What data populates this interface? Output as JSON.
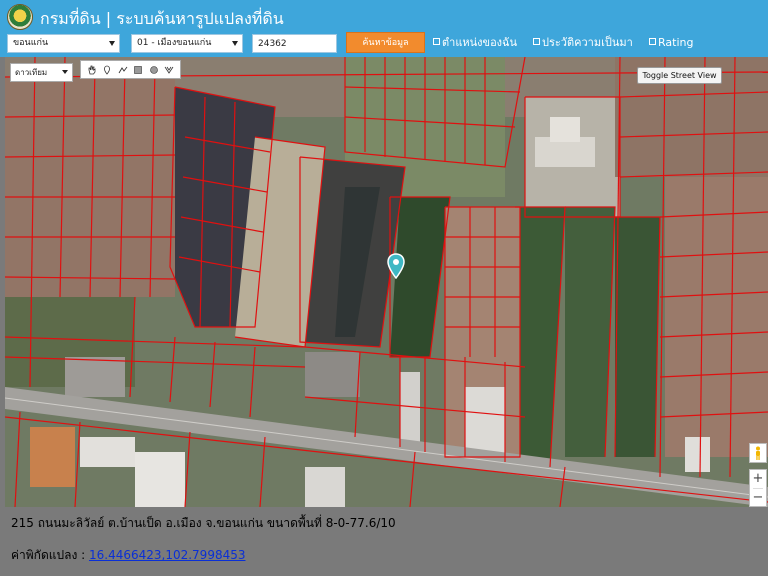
{
  "header": {
    "title": "กรมที่ดิน | ระบบค้นหารูปแปลงที่ดิน",
    "province": "ขอนแก่น",
    "district": "01 - เมืองขอนแก่น",
    "parcel_number": "24362",
    "search_label": "ค้นหาข้อมูล",
    "option_location": "ตำแหน่งของฉัน",
    "option_history": "ประวัติความเป็นมา",
    "option_rating": "Rating"
  },
  "map": {
    "map_type": "ดาวเทียม",
    "street_view_label": "Toggle Street View",
    "zoom_in": "+",
    "zoom_out": "−",
    "tools": [
      "hand-icon",
      "marker-icon",
      "polyline-icon",
      "rectangle-icon",
      "circle-icon",
      "clear-icon"
    ]
  },
  "info": {
    "address": "215 ถนนมะลิวัลย์ ต.บ้านเป็ด  อ.เมือง  จ.ขอนแก่น  ขนาดพื้นที่ 8-0-77.6/10",
    "coord_label": "ค่าพิกัดแปลง : ",
    "coordinates": "16.4466423,102.7998453"
  },
  "colors": {
    "header_bg": "#3ea6db",
    "search_button": "#f28b2d",
    "parcel_line": "#e01010",
    "marker": "#3fb8c4",
    "info_bg": "#7a7a7a",
    "link": "#0a2fd6"
  }
}
